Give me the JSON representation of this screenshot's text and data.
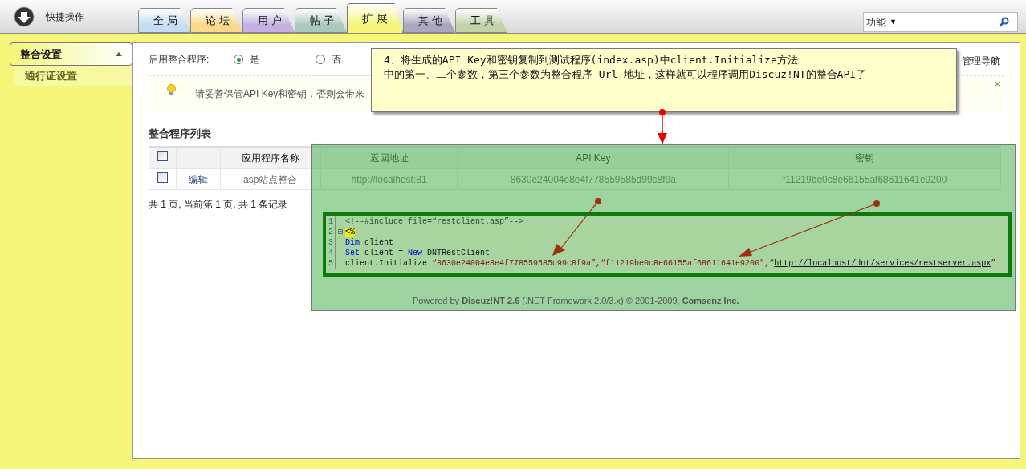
{
  "header": {
    "quick_label": "快捷操作",
    "tabs": [
      {
        "label": "全 局",
        "color": "#c4dcf4",
        "selected": false
      },
      {
        "label": "论 坛",
        "color": "#fbd98a",
        "selected": false
      },
      {
        "label": "用 户",
        "color": "#c3b1e2",
        "selected": false
      },
      {
        "label": "帖 子",
        "color": "#a9c9bd",
        "selected": false
      },
      {
        "label": "扩 展",
        "color": "#f5f57a",
        "selected": true
      },
      {
        "label": "其 他",
        "color": "#a9a7c0",
        "selected": false
      },
      {
        "label": "工 具",
        "color": "#c3d2a9",
        "selected": false
      }
    ],
    "search": {
      "dropdown": "功能",
      "caret": "▼"
    }
  },
  "sidebar": {
    "items": [
      {
        "label": "整合设置",
        "selected": true,
        "expanded": true
      },
      {
        "label": "通行证设置",
        "selected": false
      }
    ]
  },
  "nav_link": "管理导航",
  "enable": {
    "label": "启用整合程序:",
    "options": [
      {
        "label": "是",
        "selected": true
      },
      {
        "label": "否",
        "selected": false
      }
    ]
  },
  "tip": {
    "text": "请妥善保管API Key和密钥，否则会带来",
    "close": "×"
  },
  "list_title": "整合程序列表",
  "table": {
    "columns": [
      {
        "kind": "check",
        "checked": false
      },
      {
        "kind": "text"
      },
      {
        "label": "应用程序名称",
        "kind": "text"
      },
      {
        "label": "返回地址",
        "kind": "text"
      },
      {
        "label": "API Key",
        "kind": "text"
      },
      {
        "label": "密钥",
        "kind": "text"
      }
    ],
    "rows": [
      {
        "cells": [
          {
            "kind": "check",
            "checked": false
          },
          {
            "kind": "link",
            "text": "编辑"
          },
          {
            "kind": "text",
            "text": "asp站点整合"
          },
          {
            "kind": "text",
            "text": "http://localhost:81"
          },
          {
            "kind": "text",
            "text": "8630e24004e8e4f778559585d99c8f9a"
          },
          {
            "kind": "text",
            "text": "f11219be0c8e66155af68611641e9200"
          }
        ]
      }
    ]
  },
  "pager": "共 1 页, 当前第 1 页, 共 1 条记录",
  "callout": {
    "lines": [
      "4、将生成的API Key和密钥复制到测试程序(index.asp)中client.Initialize方法",
      "中的第一、二个参数，第三个参数为整合程序 Url 地址，这样就可以程序调用Discuz!NT的整合API了"
    ]
  },
  "code": {
    "lines": [
      {
        "number": "1",
        "tokens": [
          {
            "text": "<!--#include file=“restclient.asp”-->",
            "kind": "comment"
          }
        ]
      },
      {
        "number": "2",
        "fold": "⊟",
        "tokens": [
          {
            "text": "<%",
            "kind": "delimiter"
          }
        ]
      },
      {
        "number": "3",
        "tokens": [
          {
            "text": "Dim",
            "kind": "keyword"
          },
          {
            "text": " client",
            "kind": "plain"
          }
        ]
      },
      {
        "number": "4",
        "tokens": [
          {
            "text": "Set",
            "kind": "keyword"
          },
          {
            "text": " client = ",
            "kind": "plain"
          },
          {
            "text": "New",
            "kind": "keyword"
          },
          {
            "text": " DNTRestClient",
            "kind": "plain"
          }
        ]
      },
      {
        "number": "5",
        "tokens": [
          {
            "text": "client.Initialize ",
            "kind": "plain"
          },
          {
            "text": "“8630e24004e8e4f778559585d99c8f9a”",
            "kind": "string"
          },
          {
            "text": ",",
            "kind": "plain"
          },
          {
            "text": "“f11219be0c8e66155af68611641e9200”",
            "kind": "string"
          },
          {
            "text": ",“",
            "kind": "string"
          },
          {
            "text": "http://localhost/dnt/services/restserver.aspx",
            "kind": "link"
          },
          {
            "text": "”",
            "kind": "string"
          }
        ]
      }
    ]
  },
  "footer": {
    "text": "Powered by **Discuz!NT 2.6** (.NET Framework 2.0/3.x)  © 2001-2009, **Comsenz Inc.**"
  }
}
